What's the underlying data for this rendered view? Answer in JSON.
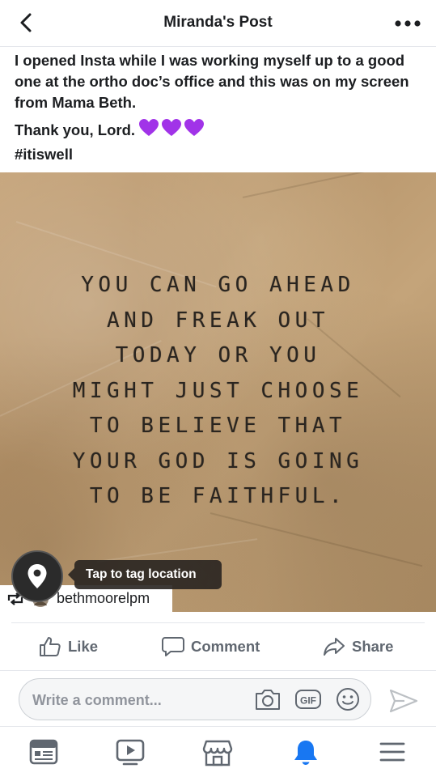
{
  "header": {
    "title": "Miranda's Post"
  },
  "post": {
    "caption_line1": "I opened Insta while I was working myself up to a good one at the ortho doc’s office and this was on my screen from Mama Beth.",
    "caption_line2": "Thank you, Lord.",
    "caption_hashtag": "#itiswell"
  },
  "image": {
    "quote_lines": [
      "YOU CAN GO AHEAD",
      "AND FREAK OUT",
      "TODAY OR YOU",
      "MIGHT JUST CHOOSE",
      "TO BELIEVE THAT",
      "YOUR GOD IS GOING",
      "TO BE FAITHFUL."
    ],
    "tag_location_label": "Tap to tag location",
    "repost_credit": "bethmoorelpm"
  },
  "actions": {
    "like_label": "Like",
    "comment_label": "Comment",
    "share_label": "Share"
  },
  "comment": {
    "placeholder": "Write a comment..."
  },
  "colors": {
    "text": "#1c1e21",
    "muted": "#606770",
    "heart": "#a133e8",
    "active_tab": "#1877f2",
    "paper": "#c4a47a"
  },
  "tabs": [
    "news-feed-icon",
    "watch-icon",
    "marketplace-icon",
    "notifications-icon",
    "menu-icon"
  ]
}
